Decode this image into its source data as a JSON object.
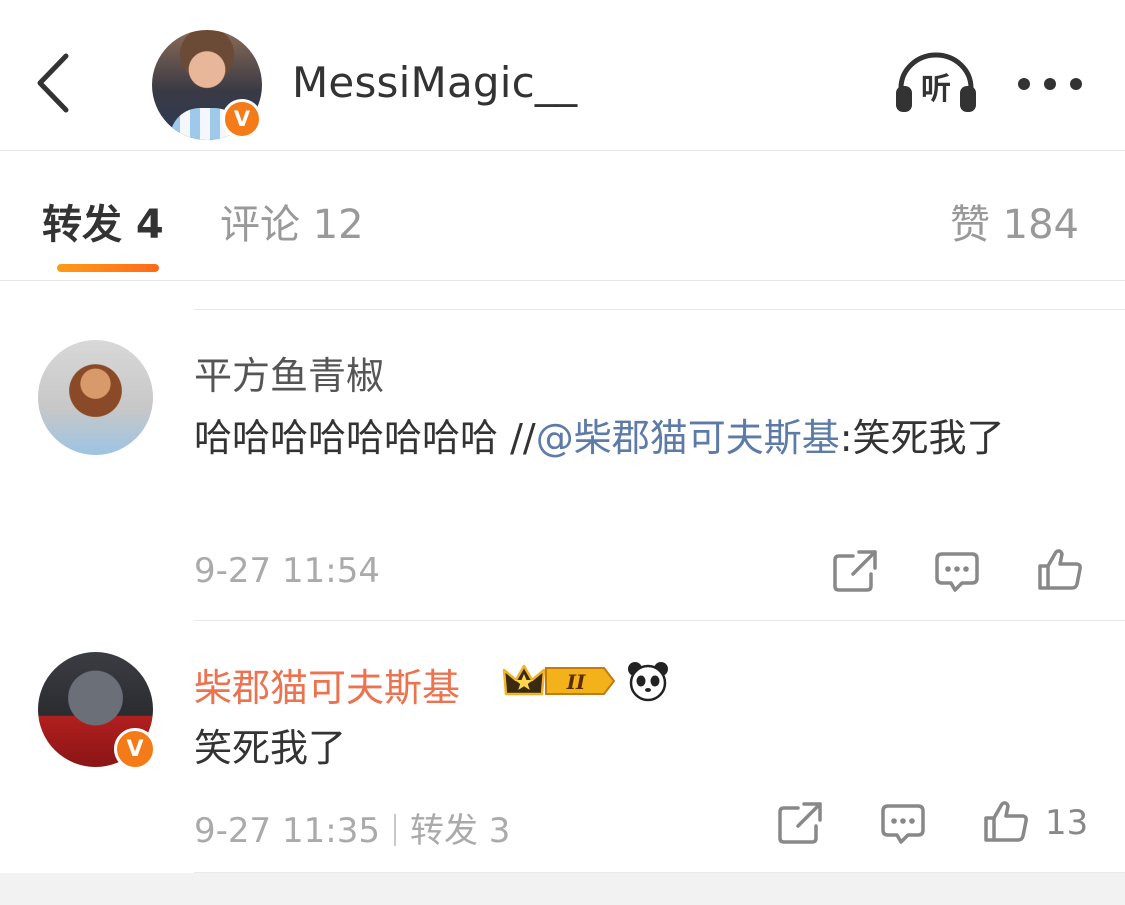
{
  "header": {
    "title": "MessiMagic__",
    "listen_label": "听",
    "verified_mark": "V",
    "back_icon": "chevron-left-icon",
    "more_icon": "more-dots-icon"
  },
  "tabs": {
    "repost": "转发 4",
    "comments": "评论 12",
    "likes": "赞 184",
    "active_color": "#ff8200"
  },
  "items": [
    {
      "username": "平方鱼青椒",
      "text_prefix": "哈哈哈哈哈哈哈哈 //",
      "mention": "@柴郡猫可夫斯基",
      "text_suffix": ":笑死我了",
      "timestamp": "9-27 11:54"
    },
    {
      "username": "柴郡猫可夫斯基",
      "verified_mark": "V",
      "level_badge": "II",
      "text": "笑死我了",
      "timestamp": "9-27 11:35",
      "repost_label": "转发 3",
      "like_count": "13"
    }
  ],
  "colors": {
    "brand_orange": "#f47b17",
    "mention_blue": "#5d7ba8",
    "vip_name": "#eb7350"
  }
}
